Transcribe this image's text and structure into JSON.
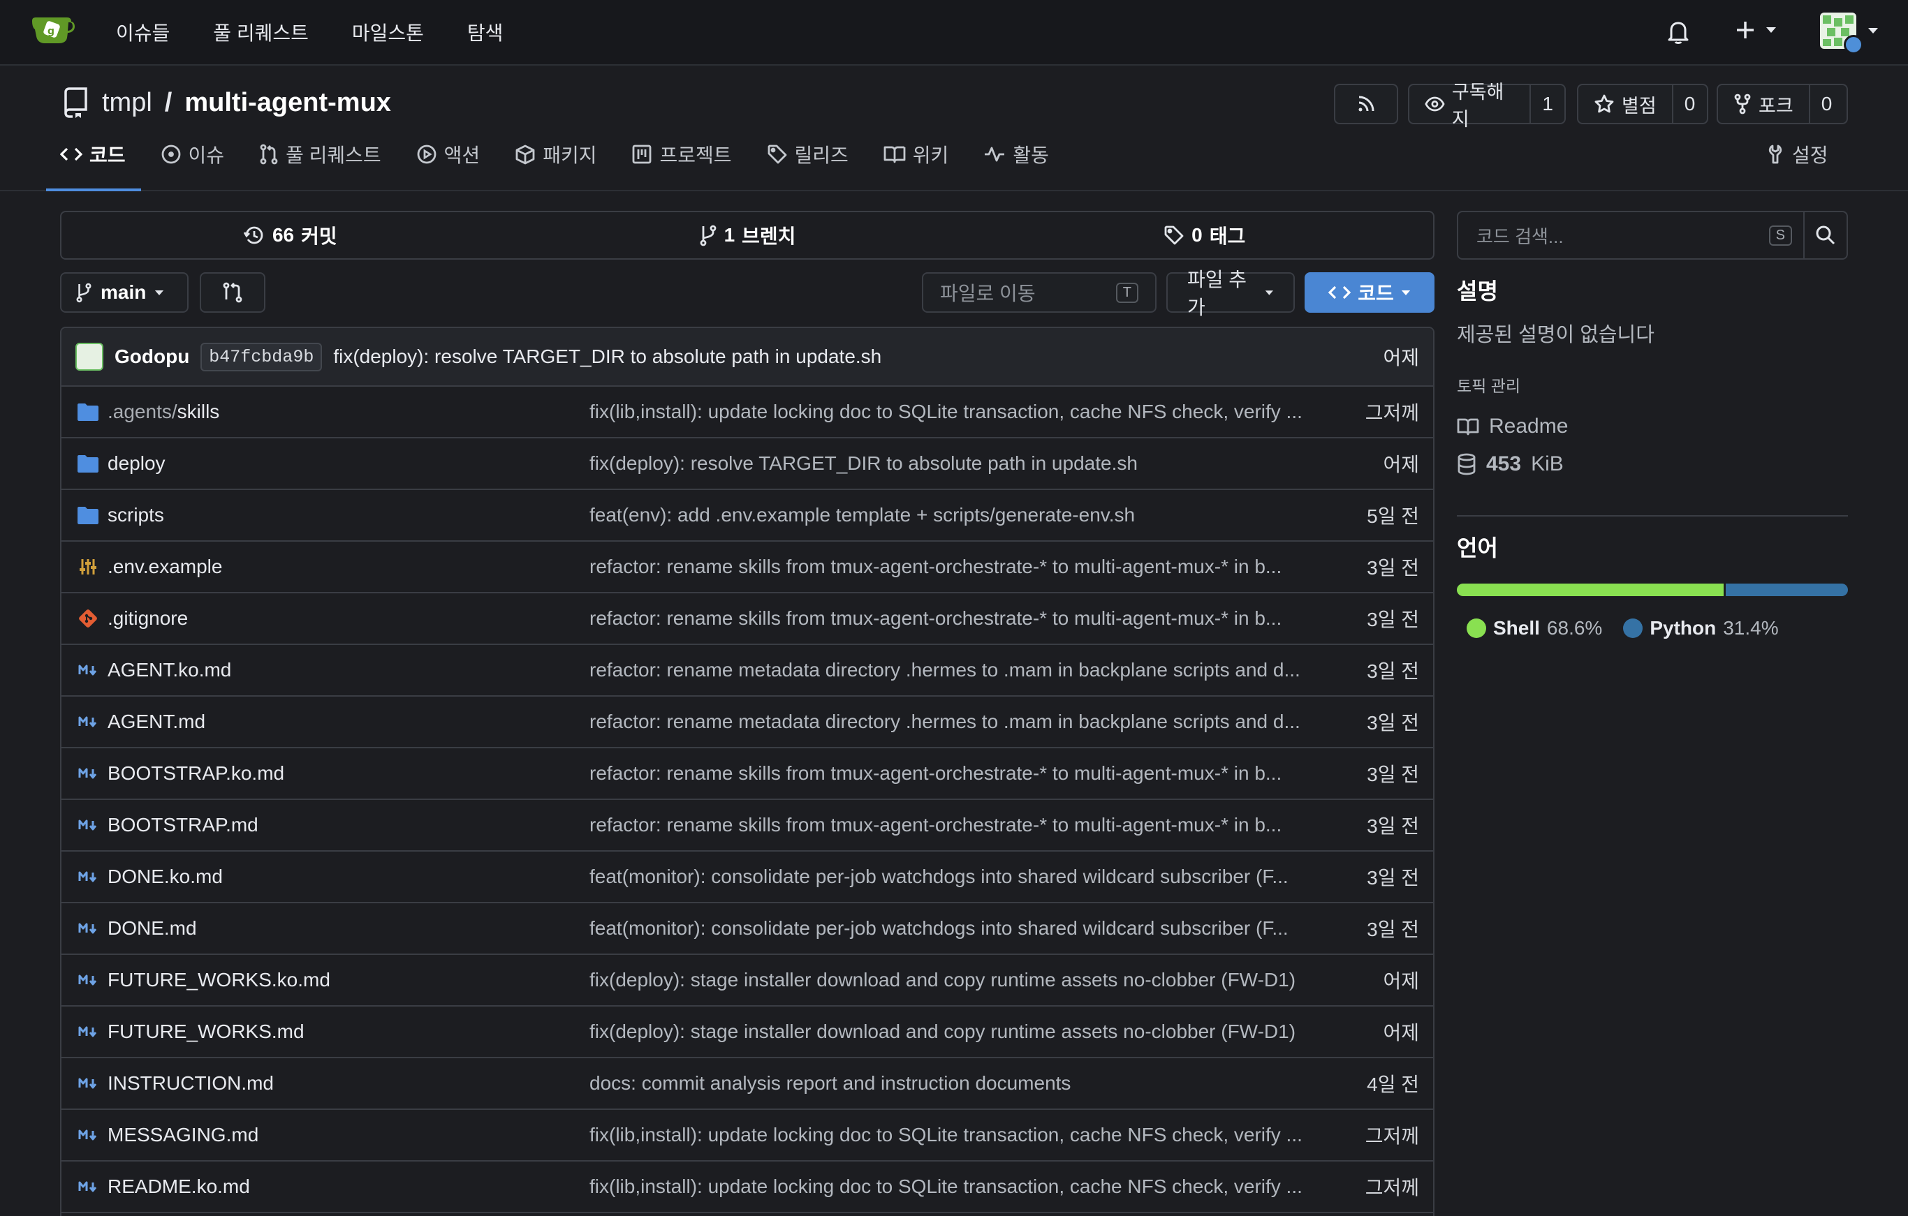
{
  "colors": {
    "accent": "#4a86d3",
    "shell": "#89e051",
    "python": "#3572A5",
    "folder": "#4f8ee0",
    "logo": "#609926"
  },
  "topnav": {
    "links": [
      "이슈들",
      "풀 리퀘스트",
      "마일스톤",
      "탐색"
    ]
  },
  "repo": {
    "owner": "tmpl",
    "sep": "/",
    "name": "multi-agent-mux",
    "watch_label": "구독해지",
    "watch_count": "1",
    "star_label": "별점",
    "star_count": "0",
    "fork_label": "포크",
    "fork_count": "0"
  },
  "tabs": [
    {
      "label": "코드",
      "icon": "code-icon"
    },
    {
      "label": "이슈",
      "icon": "issue-icon"
    },
    {
      "label": "풀 리퀘스트",
      "icon": "pull-request-icon"
    },
    {
      "label": "액션",
      "icon": "play-icon"
    },
    {
      "label": "패키지",
      "icon": "package-icon"
    },
    {
      "label": "프로젝트",
      "icon": "project-icon"
    },
    {
      "label": "릴리즈",
      "icon": "tag-icon"
    },
    {
      "label": "위키",
      "icon": "book-icon"
    },
    {
      "label": "활동",
      "icon": "pulse-icon"
    }
  ],
  "settings_label": "설정",
  "stats": {
    "commits_count": "66",
    "commits_label": "커밋",
    "branches_count": "1",
    "branches_label": "브렌치",
    "tags_count": "0",
    "tags_label": "태그"
  },
  "toolbar": {
    "branch": "main",
    "goto_placeholder": "파일로 이동",
    "goto_key": "T",
    "add_file": "파일 추가",
    "code": "코드"
  },
  "latest_commit": {
    "author": "Godopu",
    "sha": "b47fcbda9b",
    "message": "fix(deploy): resolve TARGET_DIR to absolute path in update.sh",
    "time": "어제"
  },
  "files": [
    {
      "dim": ".agents/",
      "name": "skills",
      "icon": "folder-icon",
      "commit": "fix(lib,install): update locking doc to SQLite transaction, cache NFS check, verify ...",
      "time": "그저께"
    },
    {
      "dim": "",
      "name": "deploy",
      "icon": "folder-icon",
      "commit": "fix(deploy): resolve TARGET_DIR to absolute path in update.sh",
      "time": "어제"
    },
    {
      "dim": "",
      "name": "scripts",
      "icon": "folder-icon",
      "commit": "feat(env): add .env.example template + scripts/generate-env.sh",
      "time": "5일 전"
    },
    {
      "dim": "",
      "name": ".env.example",
      "icon": "settings-file-icon",
      "commit": "refactor: rename skills from tmux-agent-orchestrate-* to multi-agent-mux-* in b...",
      "time": "3일 전"
    },
    {
      "dim": "",
      "name": ".gitignore",
      "icon": "git-icon",
      "commit": "refactor: rename skills from tmux-agent-orchestrate-* to multi-agent-mux-* in b...",
      "time": "3일 전"
    },
    {
      "dim": "",
      "name": "AGENT.ko.md",
      "icon": "markdown-icon",
      "commit": "refactor: rename metadata directory .hermes to .mam in backplane scripts and d...",
      "time": "3일 전"
    },
    {
      "dim": "",
      "name": "AGENT.md",
      "icon": "markdown-icon",
      "commit": "refactor: rename metadata directory .hermes to .mam in backplane scripts and d...",
      "time": "3일 전"
    },
    {
      "dim": "",
      "name": "BOOTSTRAP.ko.md",
      "icon": "markdown-icon",
      "commit": "refactor: rename skills from tmux-agent-orchestrate-* to multi-agent-mux-* in b...",
      "time": "3일 전"
    },
    {
      "dim": "",
      "name": "BOOTSTRAP.md",
      "icon": "markdown-icon",
      "commit": "refactor: rename skills from tmux-agent-orchestrate-* to multi-agent-mux-* in b...",
      "time": "3일 전"
    },
    {
      "dim": "",
      "name": "DONE.ko.md",
      "icon": "markdown-icon",
      "commit": "feat(monitor): consolidate per-job watchdogs into shared wildcard subscriber (F...",
      "time": "3일 전"
    },
    {
      "dim": "",
      "name": "DONE.md",
      "icon": "markdown-icon",
      "commit": "feat(monitor): consolidate per-job watchdogs into shared wildcard subscriber (F...",
      "time": "3일 전"
    },
    {
      "dim": "",
      "name": "FUTURE_WORKS.ko.md",
      "icon": "markdown-icon",
      "commit": "fix(deploy): stage installer download and copy runtime assets no-clobber (FW-D1)",
      "time": "어제"
    },
    {
      "dim": "",
      "name": "FUTURE_WORKS.md",
      "icon": "markdown-icon",
      "commit": "fix(deploy): stage installer download and copy runtime assets no-clobber (FW-D1)",
      "time": "어제"
    },
    {
      "dim": "",
      "name": "INSTRUCTION.md",
      "icon": "markdown-icon",
      "commit": "docs: commit analysis report and instruction documents",
      "time": "4일 전"
    },
    {
      "dim": "",
      "name": "MESSAGING.md",
      "icon": "markdown-icon",
      "commit": "fix(lib,install): update locking doc to SQLite transaction, cache NFS check, verify ...",
      "time": "그저께"
    },
    {
      "dim": "",
      "name": "README.ko.md",
      "icon": "markdown-icon",
      "commit": "fix(lib,install): update locking doc to SQLite transaction, cache NFS check, verify ...",
      "time": "그저께"
    }
  ],
  "sidebar": {
    "search_placeholder": "코드 검색...",
    "search_key": "S",
    "about_title": "설명",
    "about_text": "제공된 설명이 없습니다",
    "topics_label": "토픽 관리",
    "readme_label": "Readme",
    "size_value": "453",
    "size_unit": "KiB",
    "languages_title": "언어",
    "languages": [
      {
        "name": "Shell",
        "percent": "68.6%",
        "fraction": 0.686
      },
      {
        "name": "Python",
        "percent": "31.4%",
        "fraction": 0.314
      }
    ]
  }
}
